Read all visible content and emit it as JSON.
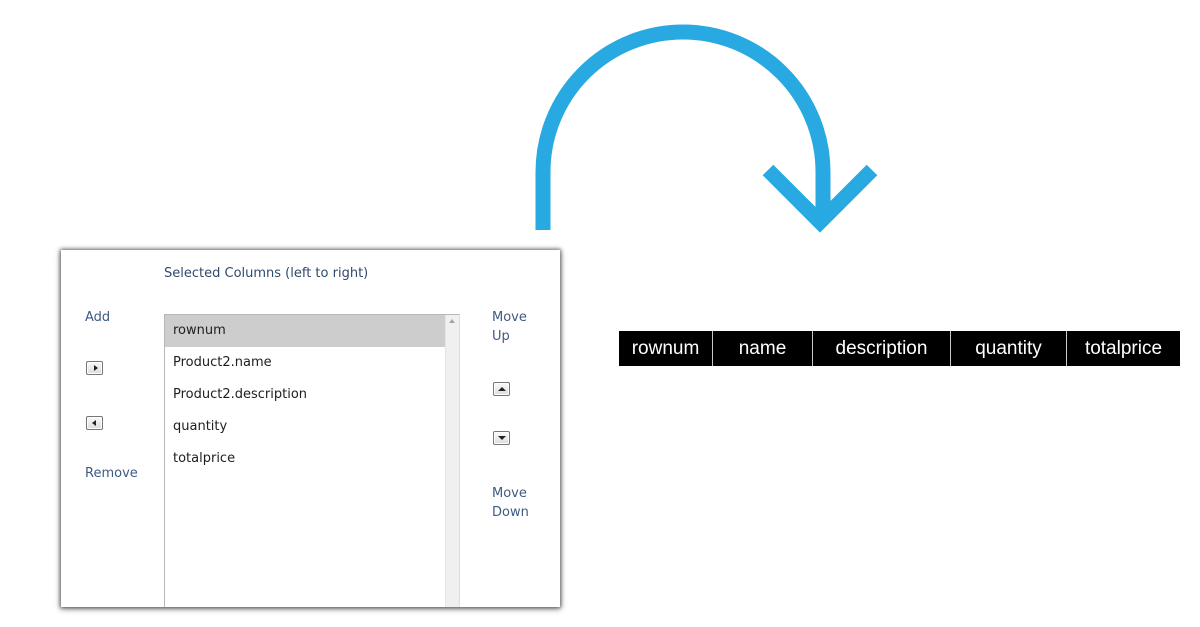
{
  "arrow": {
    "color": "#29a9e1"
  },
  "selected_columns_panel": {
    "title": "Selected Columns (left to right)",
    "add_label": "Add",
    "remove_label": "Remove",
    "move_up_label": "Move Up",
    "move_down_label": "Move Down",
    "add_icon": "triangle-right-icon",
    "remove_icon": "triangle-left-icon",
    "move_up_icon": "triangle-up-icon",
    "move_down_icon": "triangle-down-icon",
    "items": [
      {
        "label": "rownum",
        "selected": true
      },
      {
        "label": "Product2.name",
        "selected": false
      },
      {
        "label": "Product2.description",
        "selected": false
      },
      {
        "label": "quantity",
        "selected": false
      },
      {
        "label": "totalprice",
        "selected": false
      }
    ]
  },
  "result_table": {
    "header_background": "#000000",
    "header_text_color": "#ffffff",
    "headers": [
      "rownum",
      "name",
      "description",
      "quantity",
      "totalprice"
    ]
  }
}
